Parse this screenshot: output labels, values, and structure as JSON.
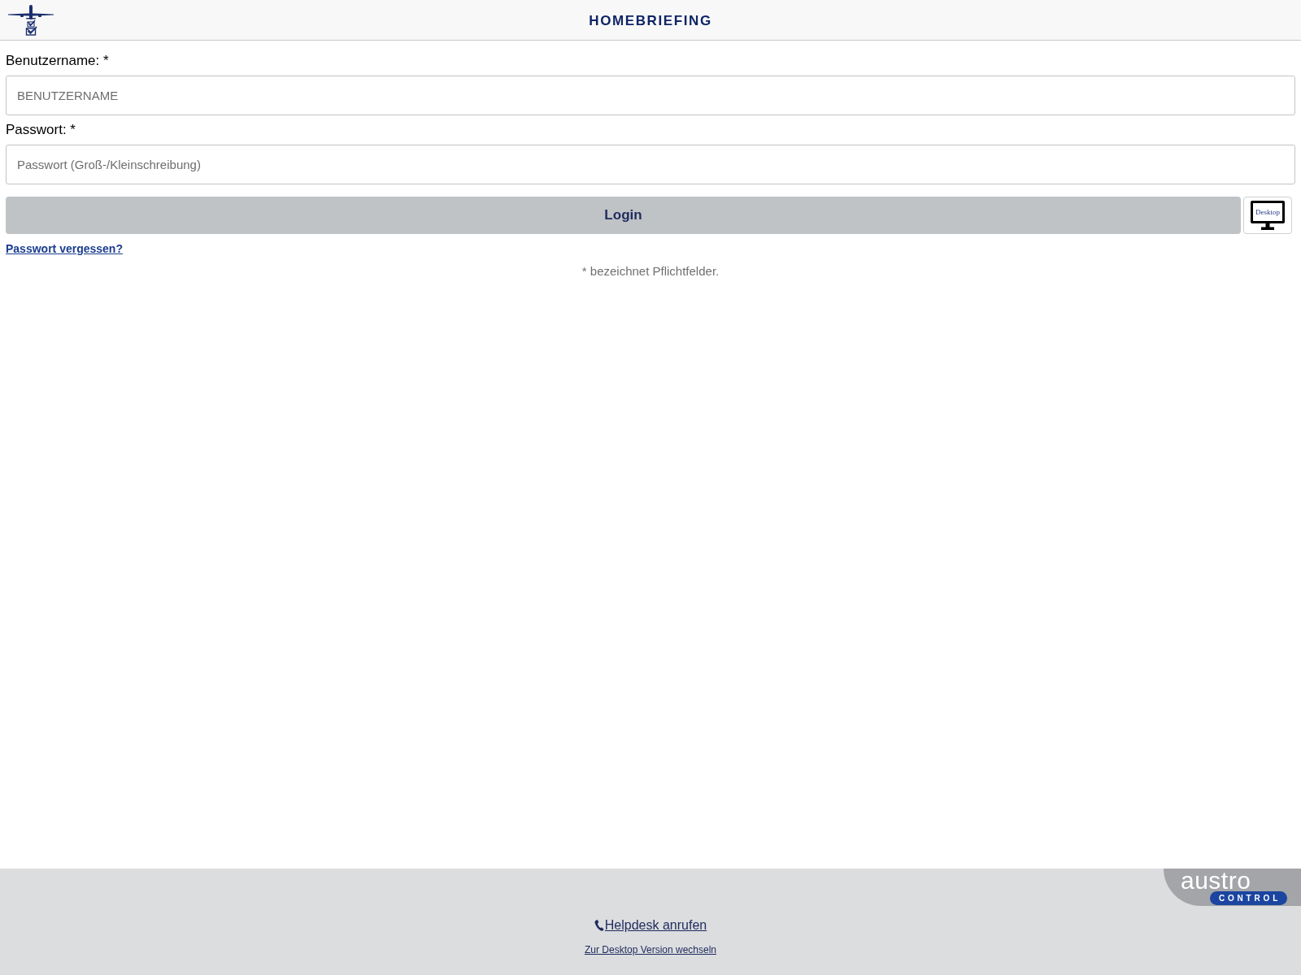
{
  "header": {
    "title": "HOMEBRIEFING"
  },
  "form": {
    "fields": [
      {
        "label": "Benutzername: *",
        "placeholder": "BENUTZERNAME"
      },
      {
        "label": "Passwort: *",
        "placeholder": "Passwort (Groß-/Kleinschreibung)"
      }
    ],
    "login_button": "Login",
    "desktop_button": {
      "screen_text": "Desktop"
    },
    "forgot_link": "Passwort vergessen?",
    "required_note": "* bezeichnet Pflichtfelder."
  },
  "footer": {
    "logo": {
      "wordmark": "austro",
      "badge": "CONTROL"
    },
    "helpdesk_link": "Helpdesk anrufen",
    "desktop_link": "Zur Desktop Version wechseln"
  }
}
